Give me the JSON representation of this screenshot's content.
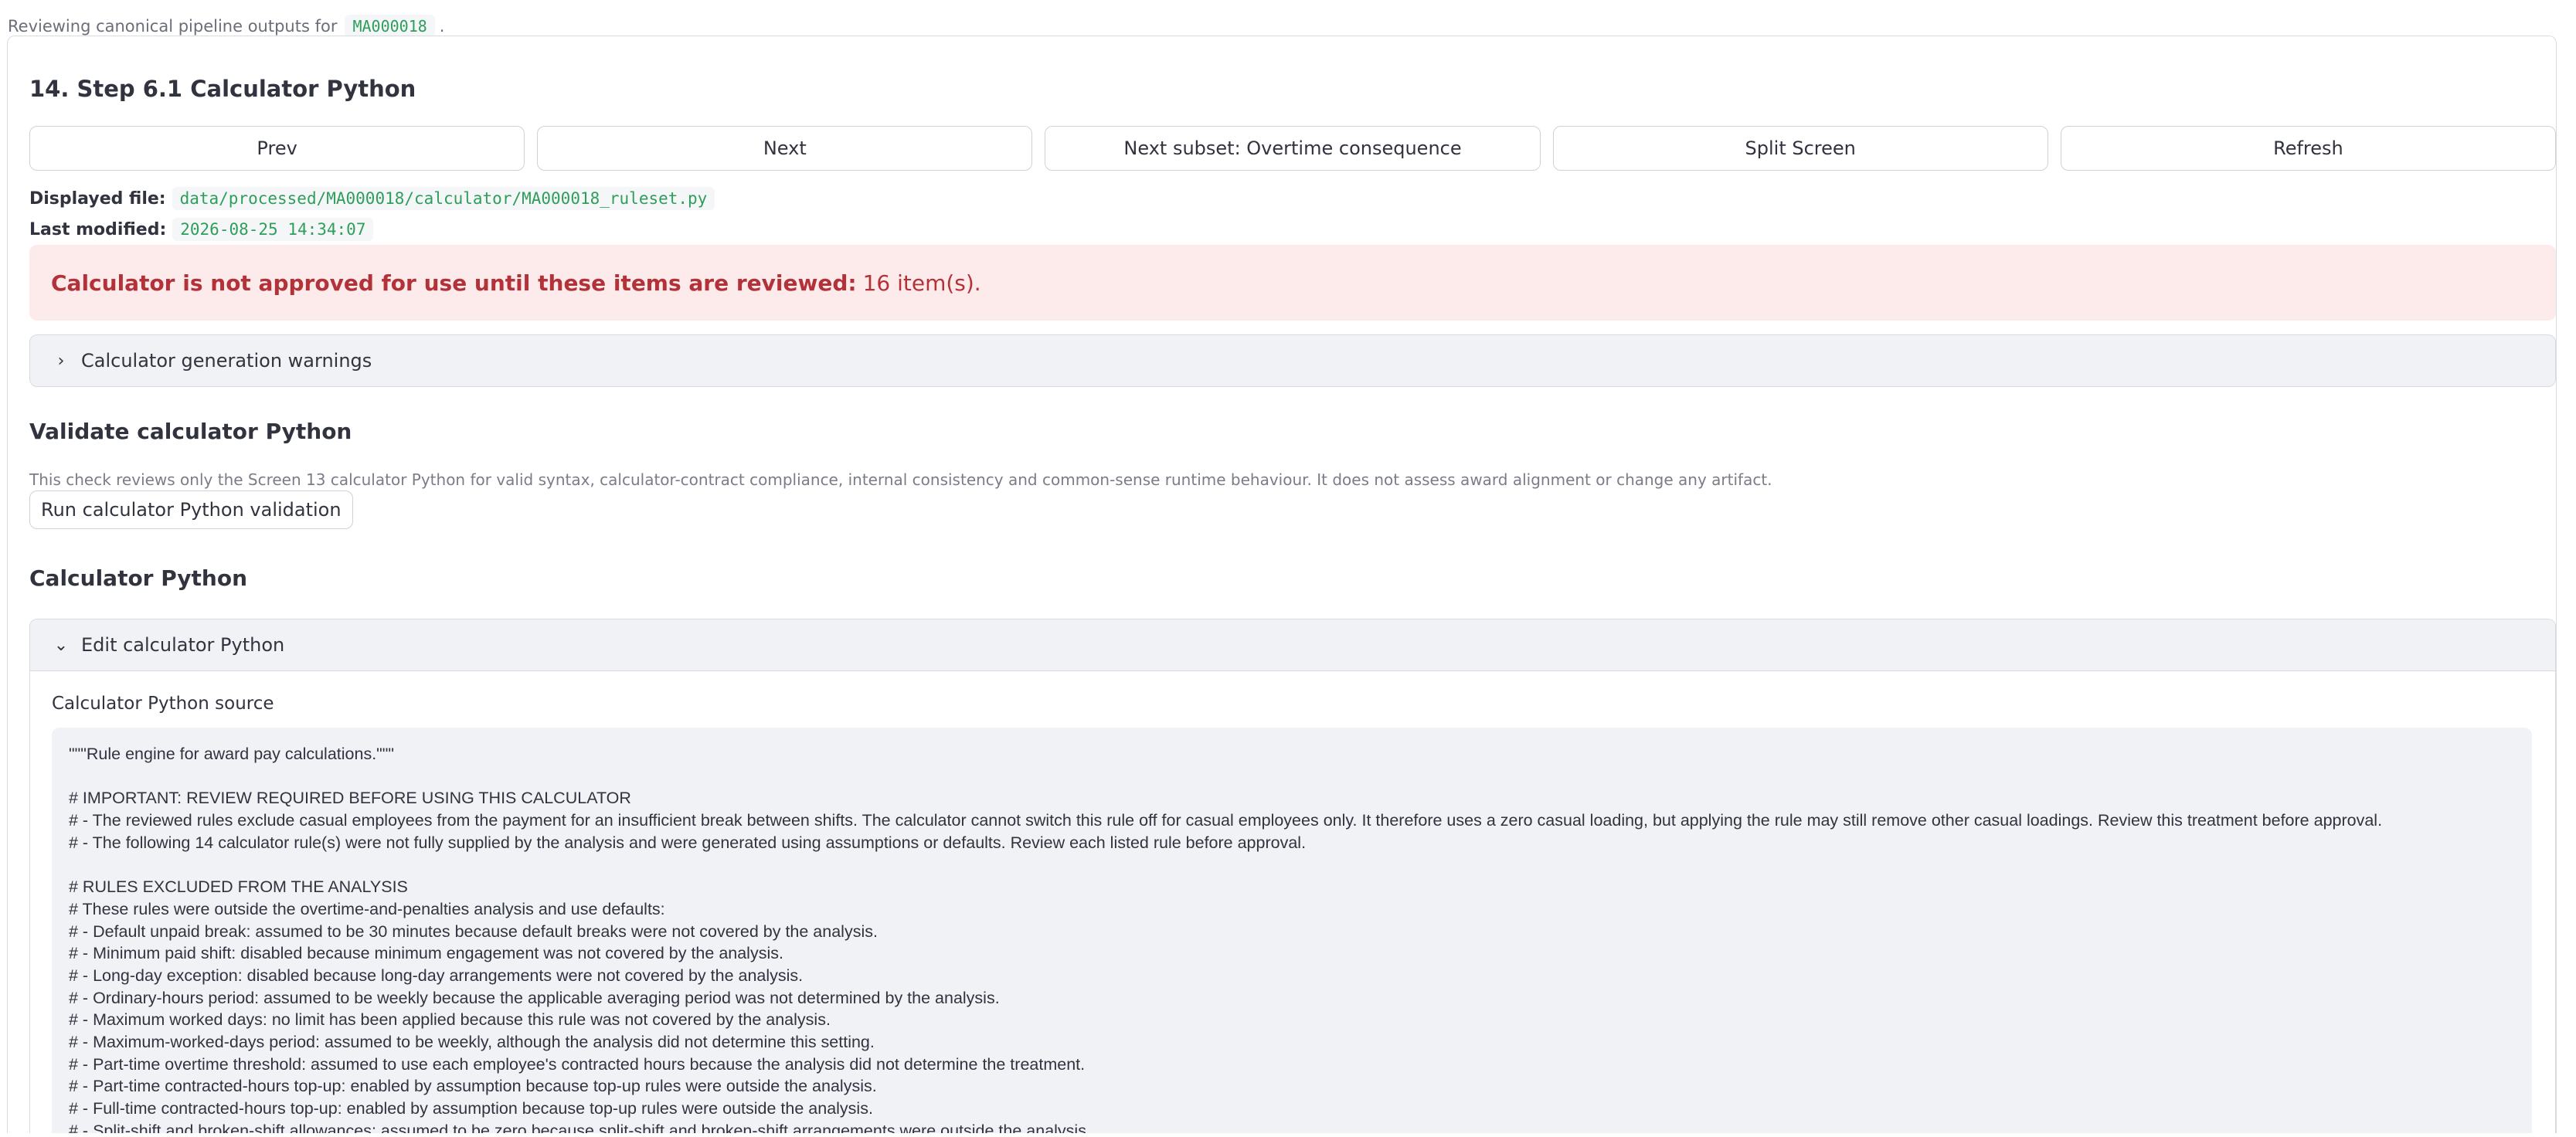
{
  "topbar": {
    "text": "Reviewing canonical pipeline outputs for",
    "code": "MA000018",
    "suffix": "."
  },
  "step": {
    "title": "14. Step 6.1 Calculator Python"
  },
  "nav": {
    "prev": "Prev",
    "next": "Next",
    "next_subset": "Next subset: Overtime consequence",
    "split_screen": "Split Screen",
    "refresh": "Refresh"
  },
  "file": {
    "displayed_label": "Displayed file:",
    "displayed_value": "data/processed/MA000018/calculator/MA000018_ruleset.py",
    "modified_label": "Last modified:",
    "modified_value": "2026-08-25 14:34:07"
  },
  "alert": {
    "text": "Calculator is not approved for use until these items are reviewed:",
    "count": "16 item(s)."
  },
  "warnings_expander": {
    "label": "Calculator generation warnings",
    "icon": "chevron-right-icon"
  },
  "validate": {
    "title": "Validate calculator Python",
    "caption": "This check reviews only the Screen 13 calculator Python for valid syntax, calculator-contract compliance, internal consistency and common-sense runtime behaviour. It does not assess award alignment or change any artifact.",
    "button": "Run calculator Python validation"
  },
  "calculator": {
    "title": "Calculator Python",
    "expander_label": "Edit calculator Python",
    "expander_icon": "chevron-down-icon",
    "source_label": "Calculator Python source",
    "code_lines": [
      "\"\"\"Rule engine for award pay calculations.\"\"\"",
      "",
      "# IMPORTANT: REVIEW REQUIRED BEFORE USING THIS CALCULATOR",
      "# - The reviewed rules exclude casual employees from the payment for an insufficient break between shifts. The calculator cannot switch this rule off for casual employees only. It therefore uses a zero casual loading, but applying the rule may still remove other casual loadings. Review this treatment before approval.",
      "# - The following 14 calculator rule(s) were not fully supplied by the analysis and were generated using assumptions or defaults. Review each listed rule before approval.",
      "",
      "# RULES EXCLUDED FROM THE ANALYSIS",
      "# These rules were outside the overtime-and-penalties analysis and use defaults:",
      "# - Default unpaid break: assumed to be 30 minutes because default breaks were not covered by the analysis.",
      "# - Minimum paid shift: disabled because minimum engagement was not covered by the analysis.",
      "# - Long-day exception: disabled because long-day arrangements were not covered by the analysis.",
      "# - Ordinary-hours period: assumed to be weekly because the applicable averaging period was not determined by the analysis.",
      "# - Maximum worked days: no limit has been applied because this rule was not covered by the analysis.",
      "# - Maximum-worked-days period: assumed to be weekly, although the analysis did not determine this setting.",
      "# - Part-time overtime threshold: assumed to use each employee's contracted hours because the analysis did not determine the treatment.",
      "# - Part-time contracted-hours top-up: enabled by assumption because top-up rules were outside the analysis.",
      "# - Full-time contracted-hours top-up: enabled by assumption because top-up rules were outside the analysis.",
      "# - Split-shift and broken-shift allowances: assumed to be zero because split-shift and broken-shift arrangements were outside the analysis."
    ]
  },
  "colors": {
    "alert_bg": "#fdeaea",
    "alert_text": "#b3323a",
    "code_green": "#2e9e5b",
    "panel_bg": "#f0f2f6"
  }
}
